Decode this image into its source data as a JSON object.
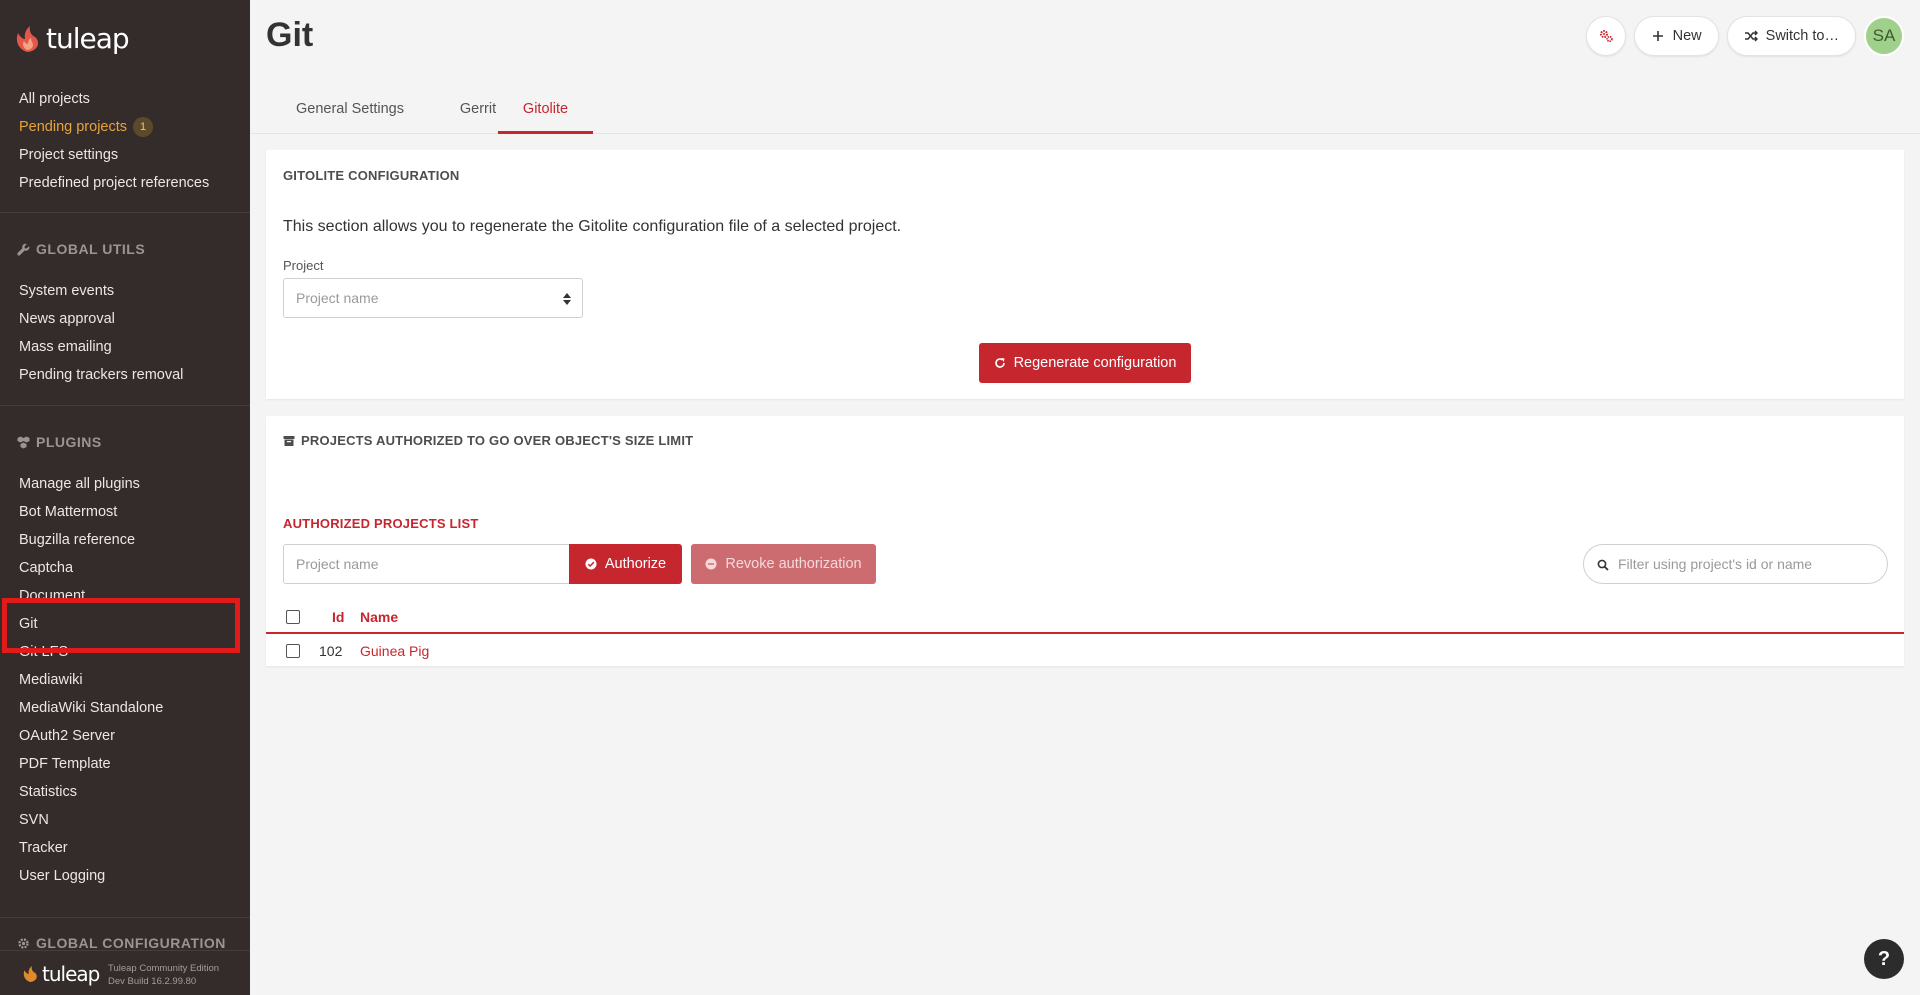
{
  "brand": {
    "name": "tuleap",
    "edition_line1": "Tuleap Community Edition",
    "edition_line2": "Dev Build 16.2.99.80"
  },
  "sidebar": {
    "admin_items": [
      {
        "label": "All projects"
      },
      {
        "label": "Pending projects",
        "badge": "1"
      },
      {
        "label": "Project settings"
      },
      {
        "label": "Predefined project references"
      }
    ],
    "global_utils": {
      "title": "GLOBAL UTILS",
      "icon": "wrench-icon",
      "items": [
        "System events",
        "News approval",
        "Mass emailing",
        "Pending trackers removal"
      ]
    },
    "plugins": {
      "title": "PLUGINS",
      "icon": "cubes-icon",
      "items": [
        "Manage all plugins",
        "Bot Mattermost",
        "Bugzilla reference",
        "Captcha",
        "Document",
        "Git",
        "Git LFS",
        "Mediawiki",
        "MediaWiki Standalone",
        "OAuth2 Server",
        "PDF Template",
        "Statistics",
        "SVN",
        "Tracker",
        "User Logging"
      ]
    },
    "global_configuration": {
      "title": "GLOBAL CONFIGURATION",
      "icon": "gear-icon"
    }
  },
  "header": {
    "title": "Git",
    "new_label": "New",
    "switch_label": "Switch to…",
    "avatar_initials": "SA"
  },
  "tabs": [
    {
      "label": "General Settings",
      "active": false
    },
    {
      "label": "Gerrit",
      "active": false
    },
    {
      "label": "Gitolite",
      "active": true
    }
  ],
  "gitolite": {
    "title": "GITOLITE CONFIGURATION",
    "description": "This section allows you to regenerate the Gitolite configuration file of a selected project.",
    "project_label": "Project",
    "project_placeholder": "Project name",
    "regenerate_label": "Regenerate configuration"
  },
  "size_limit": {
    "title": "PROJECTS AUTHORIZED TO GO OVER OBJECT'S SIZE LIMIT",
    "list_title": "AUTHORIZED PROJECTS LIST",
    "input_placeholder": "Project name",
    "authorize_label": "Authorize",
    "revoke_label": "Revoke authorization",
    "filter_placeholder": "Filter using project's id or name",
    "columns": [
      "Id",
      "Name"
    ],
    "rows": [
      {
        "id": "102",
        "name": "Guinea Pig"
      }
    ]
  },
  "help_label": "?",
  "colors": {
    "accent": "#c6262e",
    "sidebar_bg": "#342b2b",
    "warning": "#e7a43e",
    "highlight": "#e11a1a"
  }
}
